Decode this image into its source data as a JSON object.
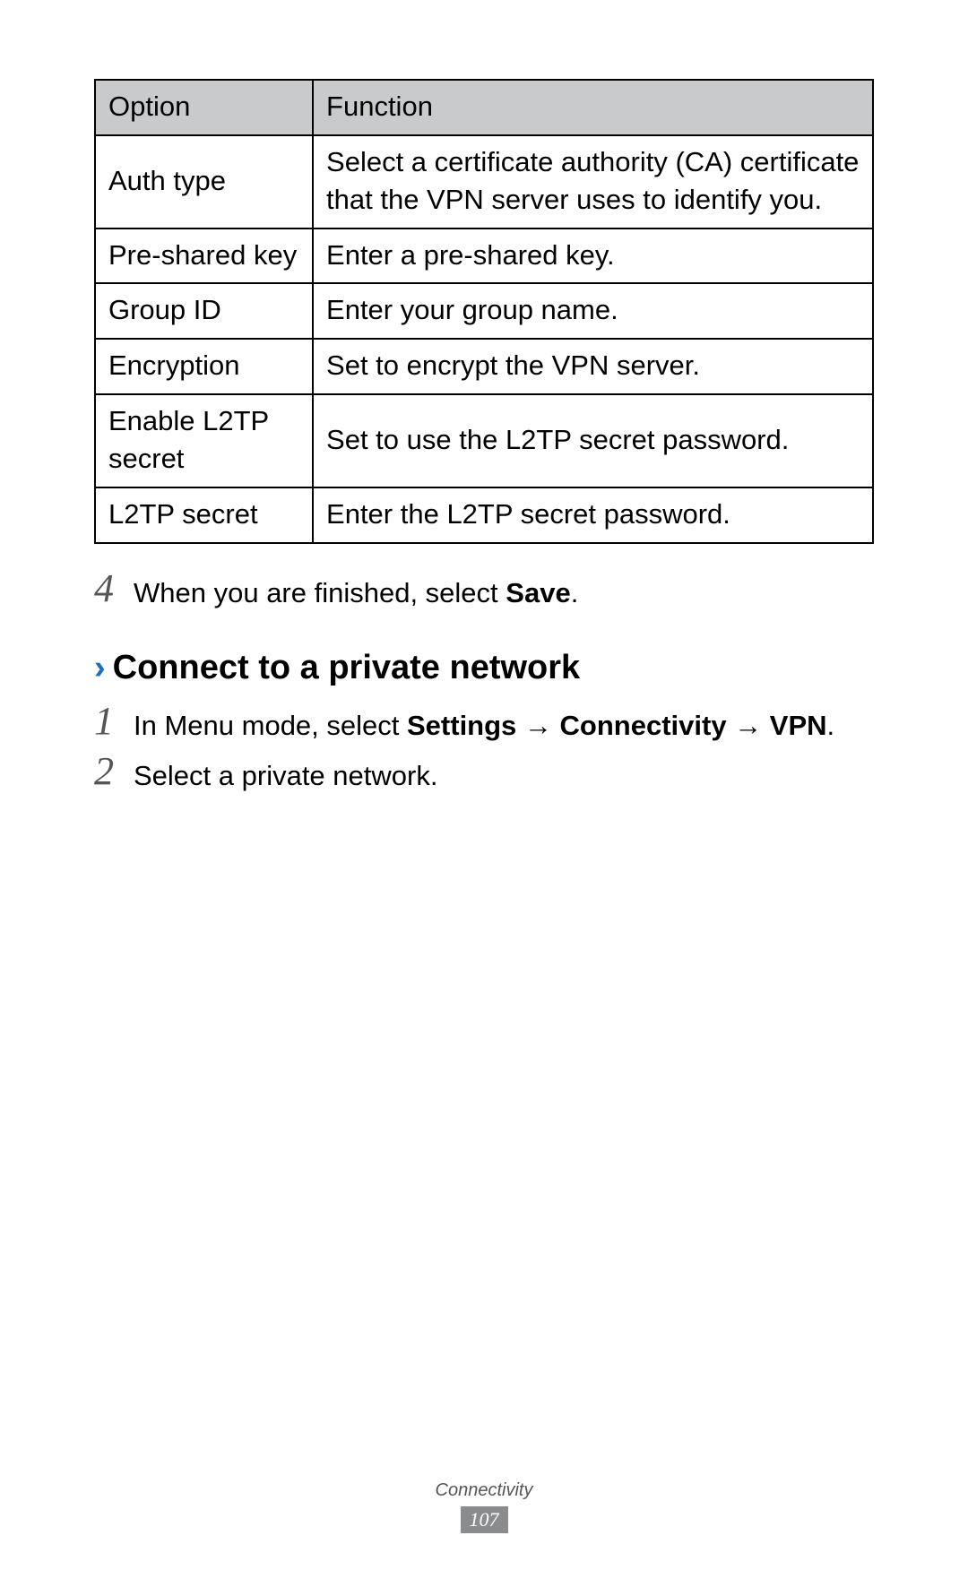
{
  "table": {
    "headers": {
      "option": "Option",
      "function": "Function"
    },
    "rows": [
      {
        "option": "Auth type",
        "function": "Select a certificate authority (CA) certificate that the VPN server uses to identify you."
      },
      {
        "option": "Pre-shared key",
        "function": "Enter a pre-shared key."
      },
      {
        "option": "Group ID",
        "function": "Enter your group name."
      },
      {
        "option": "Encryption",
        "function": "Set to encrypt the VPN server."
      },
      {
        "option": "Enable L2TP secret",
        "function": "Set to use the L2TP secret password."
      },
      {
        "option": "L2TP secret",
        "function": "Enter the L2TP secret password."
      }
    ]
  },
  "step4": {
    "num": "4",
    "prefix": "When you are finished, select ",
    "bold": "Save",
    "suffix": "."
  },
  "heading": {
    "chevron": "›",
    "text": "Connect to a private network"
  },
  "step1": {
    "num": "1",
    "prefix": "In Menu mode, select ",
    "b1": "Settings",
    "arrow1": " → ",
    "b2": "Connectivity",
    "arrow2": " → ",
    "b3": "VPN",
    "suffix": "."
  },
  "step2": {
    "num": "2",
    "text": "Select a private network."
  },
  "footer": {
    "section": "Connectivity",
    "page": "107"
  }
}
